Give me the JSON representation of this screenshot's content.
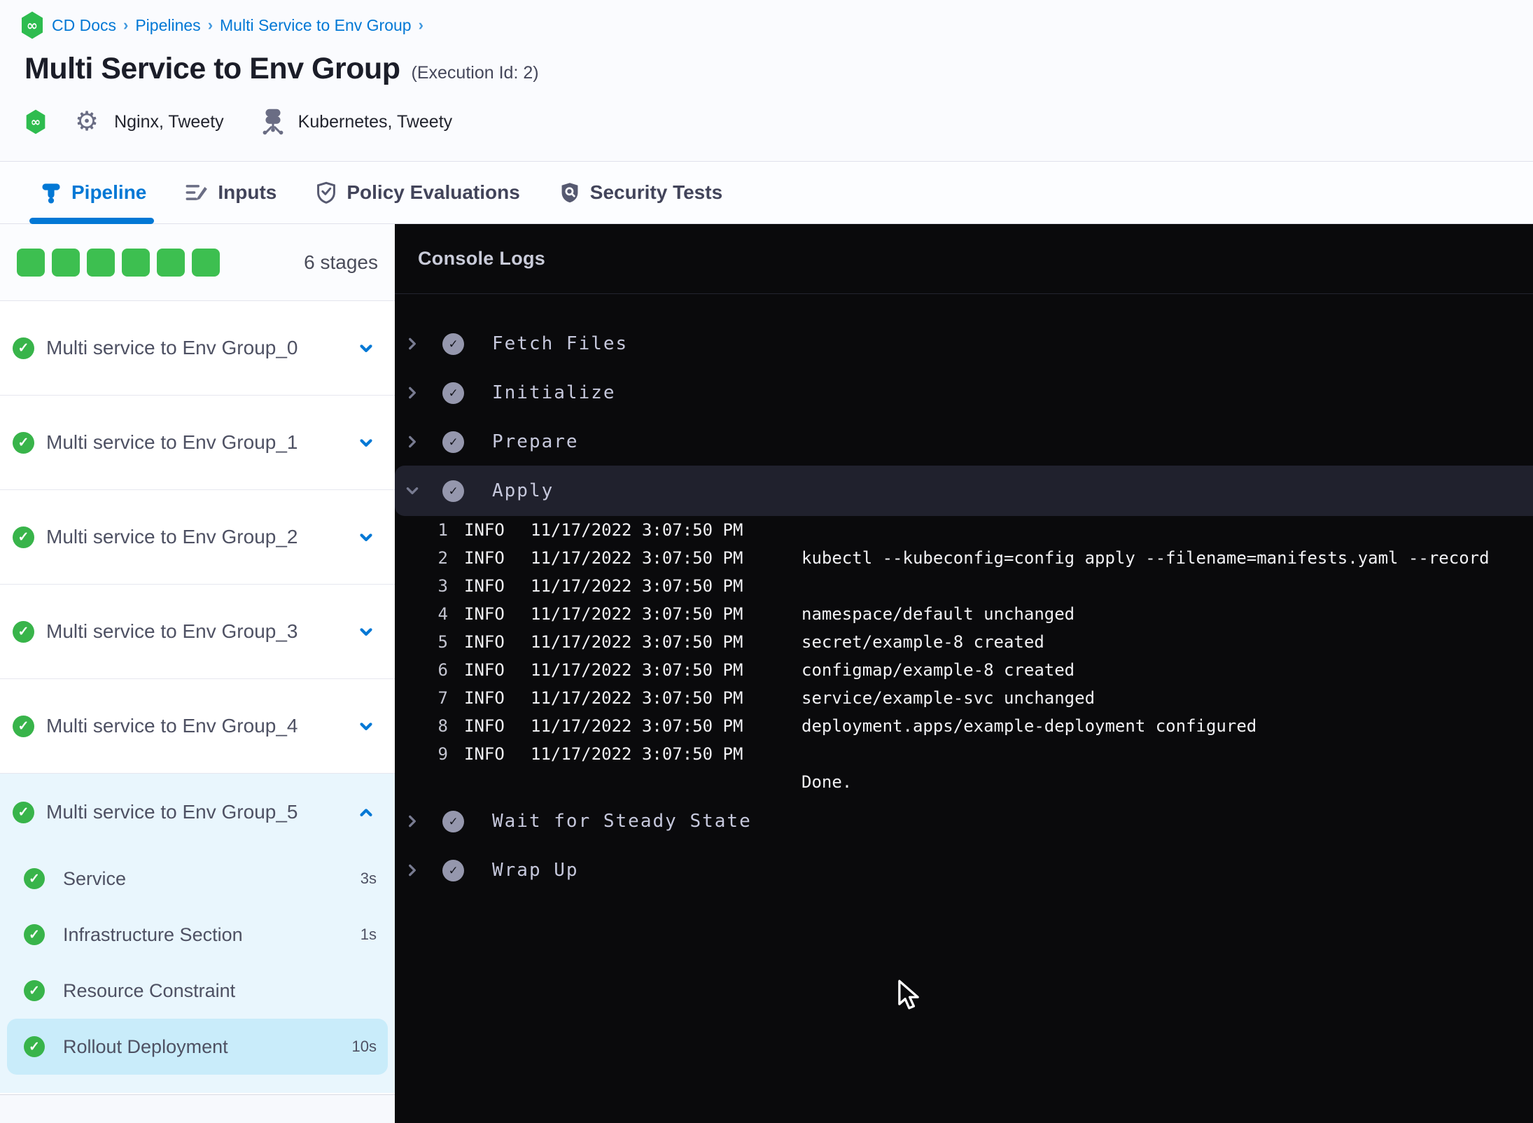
{
  "breadcrumb": {
    "items": [
      "CD Docs",
      "Pipelines",
      "Multi Service to Env Group"
    ],
    "separator": "›"
  },
  "header": {
    "title": "Multi Service to Env Group",
    "execution_id": "(Execution Id: 2)",
    "services_label": "Nginx, Tweety",
    "environments_label": "Kubernetes, Tweety"
  },
  "tabs": [
    {
      "label": "Pipeline",
      "active": true
    },
    {
      "label": "Inputs",
      "active": false
    },
    {
      "label": "Policy Evaluations",
      "active": false
    },
    {
      "label": "Security Tests",
      "active": false
    }
  ],
  "sidebar": {
    "stages_count_label": "6 stages",
    "progress_squares": 6,
    "stages": [
      {
        "name": "Multi service to Env Group_0"
      },
      {
        "name": "Multi service to Env Group_1"
      },
      {
        "name": "Multi service to Env Group_2"
      },
      {
        "name": "Multi service to Env Group_3"
      },
      {
        "name": "Multi service to Env Group_4"
      }
    ],
    "expanded_stage": {
      "name": "Multi service to Env Group_5",
      "steps": [
        {
          "name": "Service",
          "duration": "3s"
        },
        {
          "name": "Infrastructure Section",
          "duration": "1s"
        },
        {
          "name": "Resource Constraint",
          "duration": ""
        },
        {
          "name": "Rollout Deployment",
          "duration": "10s",
          "selected": true
        }
      ]
    }
  },
  "console": {
    "title": "Console Logs",
    "sections": [
      {
        "name": "Fetch Files"
      },
      {
        "name": "Initialize"
      },
      {
        "name": "Prepare"
      },
      {
        "name": "Apply",
        "expanded": true
      },
      {
        "name": "Wait for Steady State"
      },
      {
        "name": "Wrap Up"
      }
    ],
    "logs": {
      "lines": [
        {
          "n": "1",
          "level": "INFO",
          "time": "11/17/2022 3:07:50 PM",
          "msg": ""
        },
        {
          "n": "2",
          "level": "INFO",
          "time": "11/17/2022 3:07:50 PM",
          "msg": "kubectl --kubeconfig=config apply --filename=manifests.yaml --record"
        },
        {
          "n": "3",
          "level": "INFO",
          "time": "11/17/2022 3:07:50 PM",
          "msg": ""
        },
        {
          "n": "4",
          "level": "INFO",
          "time": "11/17/2022 3:07:50 PM",
          "msg": "namespace/default unchanged"
        },
        {
          "n": "5",
          "level": "INFO",
          "time": "11/17/2022 3:07:50 PM",
          "msg": "secret/example-8 created"
        },
        {
          "n": "6",
          "level": "INFO",
          "time": "11/17/2022 3:07:50 PM",
          "msg": "configmap/example-8 created"
        },
        {
          "n": "7",
          "level": "INFO",
          "time": "11/17/2022 3:07:50 PM",
          "msg": "service/example-svc unchanged"
        },
        {
          "n": "8",
          "level": "INFO",
          "time": "11/17/2022 3:07:50 PM",
          "msg": "deployment.apps/example-deployment configured"
        },
        {
          "n": "9",
          "level": "INFO",
          "time": "11/17/2022 3:07:50 PM",
          "msg": ""
        }
      ],
      "footer": "Done."
    }
  },
  "colors": {
    "accent_blue": "#0278d5",
    "success_green": "#38b44a",
    "progress_green": "#3dbf50",
    "selected_step_bg": "#c9ecfa",
    "expanded_group_bg": "#e9f6fd",
    "console_bg": "#0a0a0c",
    "console_highlight": "#20212d"
  }
}
